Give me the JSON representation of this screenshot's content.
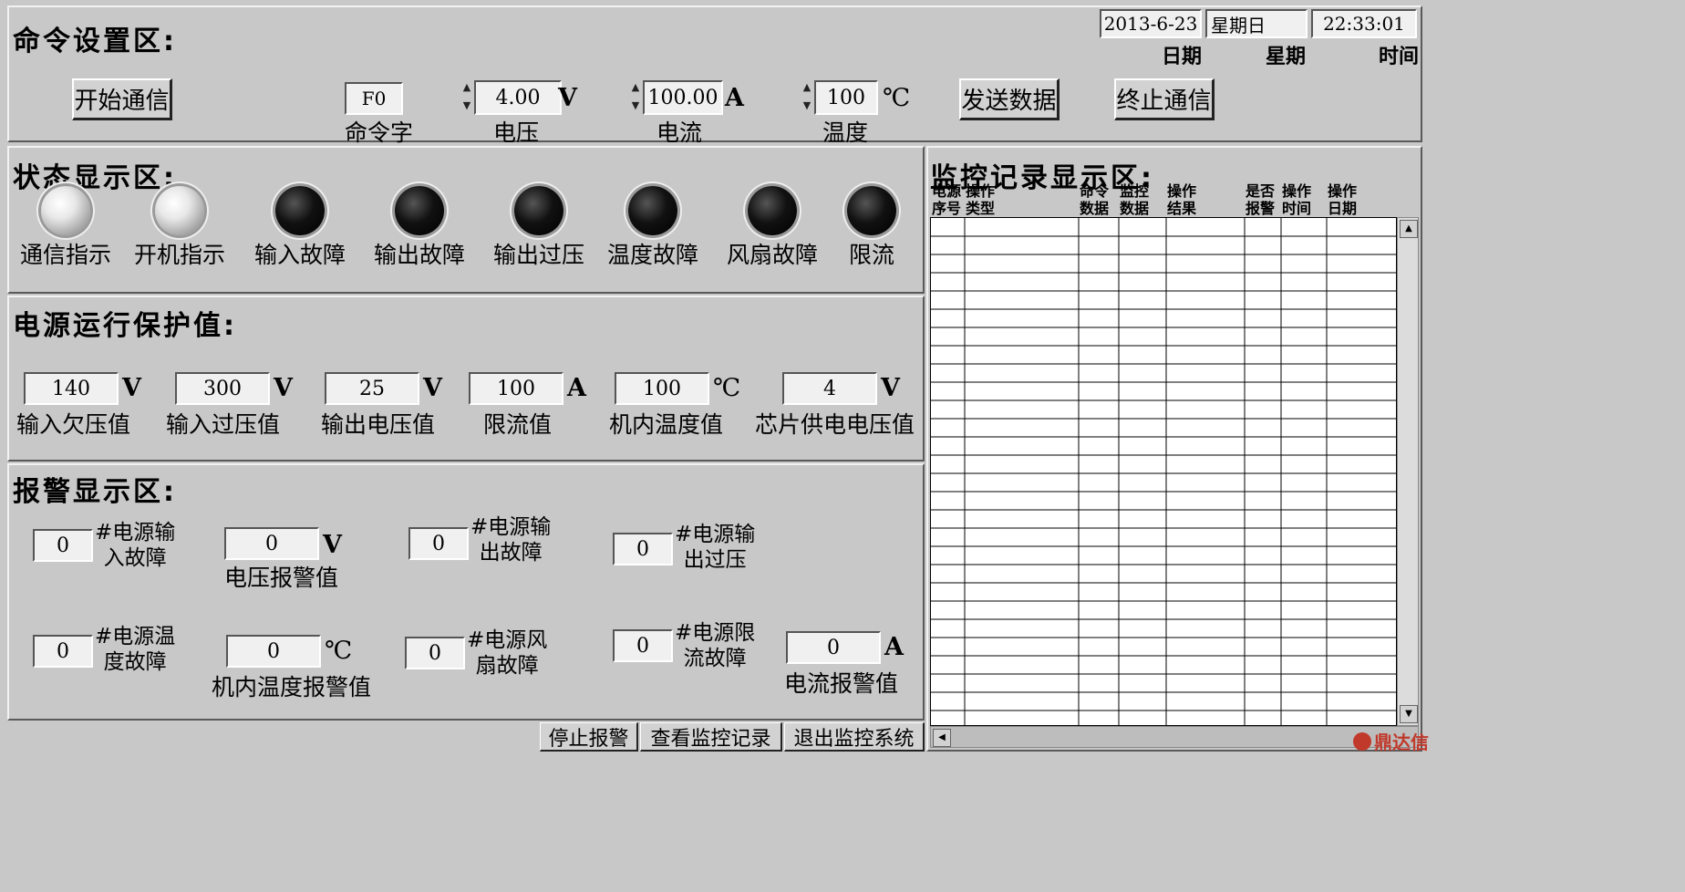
{
  "command_area": {
    "title": "命令设置区:",
    "date": "2013-6-23",
    "weekday": "星期日",
    "time": "22:33:01",
    "date_label": "日期",
    "weekday_label": "星期",
    "time_label": "时间",
    "start_button": "开始通信",
    "send_button": "发送数据",
    "stop_button": "终止通信",
    "command_word": {
      "value": "F0",
      "label": "命令字"
    },
    "voltage": {
      "value": "4.00",
      "unit": "V",
      "label": "电压"
    },
    "current": {
      "value": "100.00",
      "unit": "A",
      "label": "电流"
    },
    "temperature": {
      "value": "100",
      "unit": "℃",
      "label": "温度"
    }
  },
  "status_area": {
    "title": "状态显示区:",
    "indicators": [
      {
        "label": "通信指示",
        "state": "on"
      },
      {
        "label": "开机指示",
        "state": "on"
      },
      {
        "label": "输入故障",
        "state": "off"
      },
      {
        "label": "输出故障",
        "state": "off"
      },
      {
        "label": "输出过压",
        "state": "off"
      },
      {
        "label": "温度故障",
        "state": "off"
      },
      {
        "label": "风扇故障",
        "state": "off"
      },
      {
        "label": "限流",
        "state": "off"
      }
    ]
  },
  "protection_area": {
    "title": "电源运行保护值:",
    "items": [
      {
        "value": "140",
        "unit": "V",
        "label": "输入欠压值"
      },
      {
        "value": "300",
        "unit": "V",
        "label": "输入过压值"
      },
      {
        "value": "25",
        "unit": "V",
        "label": "输出电压值"
      },
      {
        "value": "100",
        "unit": "A",
        "label": "限流值"
      },
      {
        "value": "100",
        "unit": "℃",
        "label": "机内温度值"
      },
      {
        "value": "4",
        "unit": "V",
        "label": "芯片供电电压值"
      }
    ]
  },
  "alarm_area": {
    "title": "报警显示区:",
    "input_fault": {
      "value": "0",
      "line1": "#电源输",
      "line2": "入故障"
    },
    "voltage_alarm": {
      "value": "0",
      "unit": "V",
      "label": "电压报警值"
    },
    "output_fault": {
      "value": "0",
      "line1": "#电源输",
      "line2": "出故障"
    },
    "output_over": {
      "value": "0",
      "line1": "#电源输",
      "line2": "出过压"
    },
    "temp_fault": {
      "value": "0",
      "line1": "#电源温",
      "line2": "度故障"
    },
    "temp_alarm": {
      "value": "0",
      "unit": "℃",
      "label": "机内温度报警值"
    },
    "fan_fault": {
      "value": "0",
      "line1": "#电源风",
      "line2": "扇故障"
    },
    "limit_fault": {
      "value": "0",
      "line1": "#电源限",
      "line2": "流故障"
    },
    "current_alarm": {
      "value": "0",
      "unit": "A",
      "label": "电流报警值"
    }
  },
  "monitor_area": {
    "title": "监控记录显示区:",
    "columns": [
      {
        "l1": "电源",
        "l2": "序号"
      },
      {
        "l1": "操作",
        "l2": "类型"
      },
      {
        "l1": "命令",
        "l2": "数据"
      },
      {
        "l1": "监控",
        "l2": "数据"
      },
      {
        "l1": "操作",
        "l2": "结果"
      },
      {
        "l1": "是否",
        "l2": "报警"
      },
      {
        "l1": "操作",
        "l2": "时间"
      },
      {
        "l1": "操作",
        "l2": "日期"
      }
    ]
  },
  "footer": {
    "stop_alarm": "停止报警",
    "view_records": "查看监控记录",
    "exit": "退出监控系统",
    "logo": "鼎达信"
  }
}
